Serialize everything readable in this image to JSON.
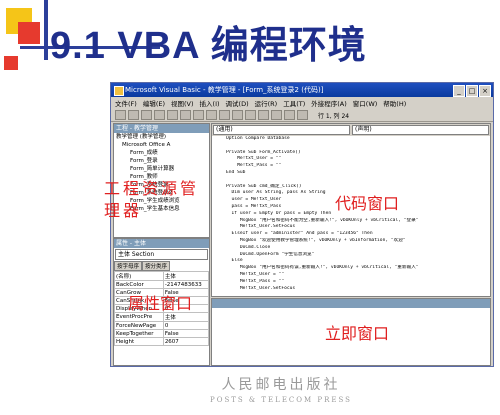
{
  "slide": {
    "title": "9.1 VBA 编程环境"
  },
  "window": {
    "title": "Microsoft Visual Basic - 教学管理 - [Form_系统登录2 (代码)]",
    "menu": [
      "文件(F)",
      "编辑(E)",
      "视图(V)",
      "插入(I)",
      "调试(D)",
      "运行(R)",
      "工具(T)",
      "外接程序(A)",
      "窗口(W)",
      "帮助(H)"
    ],
    "cursor_position": "行 1, 列 24"
  },
  "project_pane": {
    "title": "工程 - 教学管理",
    "items": [
      "教学管理 (教学管理)",
      "Microsoft Office A",
      "Form_成绩",
      "Form_登录",
      "Form_简单计算器",
      "Form_教师",
      "Form_系统登录",
      "Form_系统登录2",
      "Form_学生成绩浏览",
      "Form_学生基本信息"
    ]
  },
  "properties_pane": {
    "title": "属性 - 主体",
    "object": "主体 Section",
    "tabs": [
      "按字母序",
      "按分类序"
    ],
    "rows": [
      [
        "(名称)",
        "主体"
      ],
      [
        "BackColor",
        "-2147483633"
      ],
      [
        "CanGrow",
        "False"
      ],
      [
        "CanShrink",
        "False"
      ],
      [
        "DisplayWhen",
        "0"
      ],
      [
        "EventProcPre",
        "主体"
      ],
      [
        "ForceNewPage",
        "0"
      ],
      [
        "KeepTogether",
        "False"
      ],
      [
        "Height",
        "2607"
      ]
    ]
  },
  "code_pane": {
    "object_combo": "(通用)",
    "proc_combo": "(声明)",
    "lines": [
      "Option Compare Database",
      "",
      "Private Sub Form_Activate()",
      "    Me!txt_User = \"\"",
      "    Me!txt_Pass = \"\"",
      "End Sub",
      "",
      "Private Sub cmd_确定_Click()",
      "  Dim user As String, pass As String",
      "  user = Me!txt_User",
      "  pass = Me!txt_Pass",
      "  If user = Empty Or pass = Empty Then",
      "     MsgBox \"用户名和密码不能为空,重新输入!\", vbOKOnly + vbCritical, \"登录\"",
      "     Me!txt_User.SetFocus",
      "  ElseIf user = \"administer\" And pass = \"123456\" Then",
      "     MsgBox \"欢迎使用教学管理系统!\", vbOKOnly + vbInformation, \"欢迎\"",
      "     DoCmd.Close",
      "     DoCmd.OpenForm \"学生信息浏览\"",
      "  Else",
      "     MsgBox \"用户名和密码有误,重新输入!\", vbOKOnly + vbCritical, \"重新输入\"",
      "     Me!txt_User = \"\"",
      "     Me!txt_Pass = \"\"",
      "     Me!txt_User.SetFocus"
    ]
  },
  "annotations": {
    "project": "工程资源管理器",
    "code": "代码窗口",
    "properties": "属性窗口",
    "immediate": "立即窗口"
  },
  "publisher": {
    "cn": "人民邮电出版社",
    "en": "POSTS & TELECOM PRESS"
  },
  "colors": {
    "title_blue": "#1f2f8c",
    "annotation_red": "#e02020",
    "deco_red": "#e63a2e",
    "deco_yellow": "#f5c518",
    "deco_blue": "#2c3f9a"
  }
}
